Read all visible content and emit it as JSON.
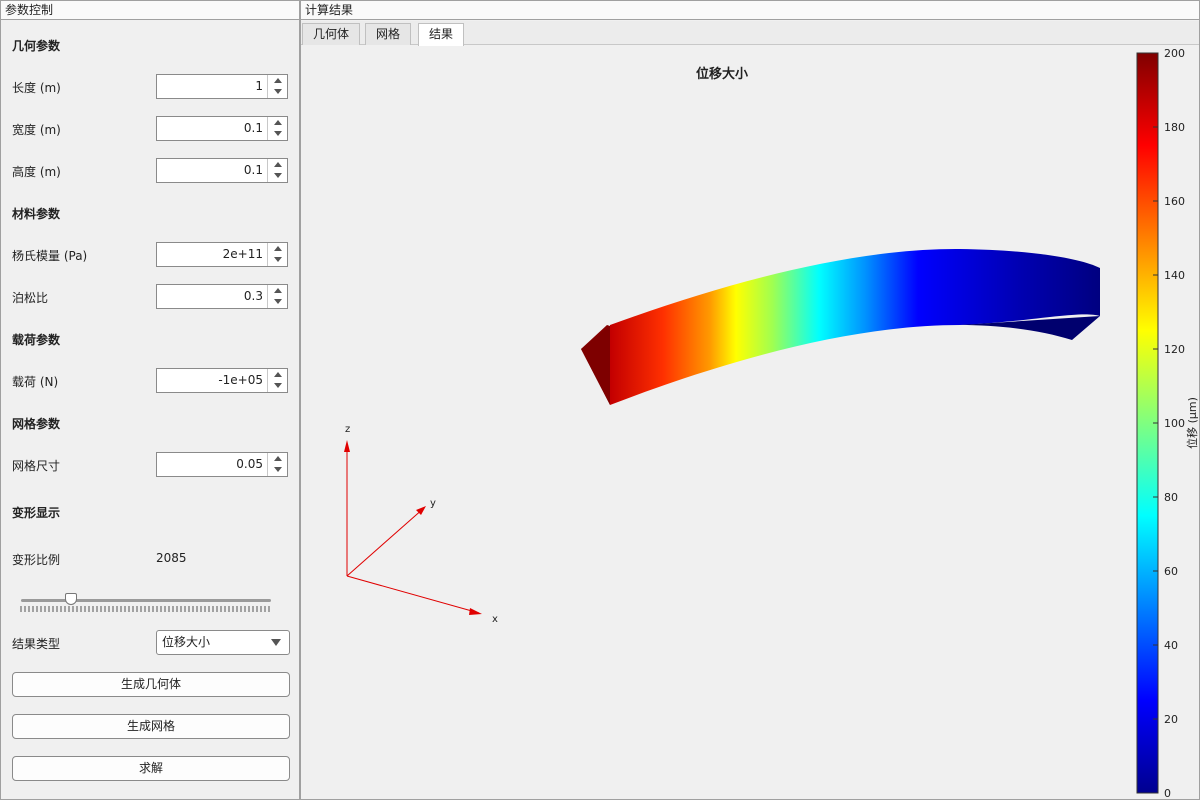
{
  "left_panel": {
    "title": "参数控制",
    "geometry_section": "几何参数",
    "length": {
      "label": "长度 (m)",
      "value": "1"
    },
    "width": {
      "label": "宽度 (m)",
      "value": "0.1"
    },
    "height": {
      "label": "高度 (m)",
      "value": "0.1"
    },
    "material_section": "材料参数",
    "youngs": {
      "label": "杨氏模量 (Pa)",
      "value": "2e+11"
    },
    "poisson": {
      "label": "泊松比",
      "value": "0.3"
    },
    "load_section": "载荷参数",
    "load": {
      "label": "载荷 (N)",
      "value": "-1e+05"
    },
    "mesh_section": "网格参数",
    "mesh_size": {
      "label": "网格尺寸",
      "value": "0.05"
    },
    "deform_section": "变形显示",
    "deform_scale": {
      "label": "变形比例",
      "value": "2085",
      "slider_fraction": 0.2
    },
    "result_type": {
      "label": "结果类型",
      "value": "位移大小"
    },
    "buttons": {
      "gen_geometry": "生成几何体",
      "gen_mesh": "生成网格",
      "solve": "求解"
    }
  },
  "right_panel": {
    "title": "计算结果",
    "tabs": [
      {
        "label": "几何体",
        "active": false
      },
      {
        "label": "网格",
        "active": false
      },
      {
        "label": "结果",
        "active": true
      }
    ],
    "plot_title": "位移大小",
    "axes": {
      "x": "x",
      "y": "y",
      "z": "z"
    },
    "colorbar": {
      "label": "位移 (μm)",
      "ticks": [
        "0",
        "20",
        "40",
        "60",
        "80",
        "100",
        "120",
        "140",
        "160",
        "180",
        "200"
      ]
    }
  },
  "colors": {
    "axis_triad": "#e00000"
  }
}
